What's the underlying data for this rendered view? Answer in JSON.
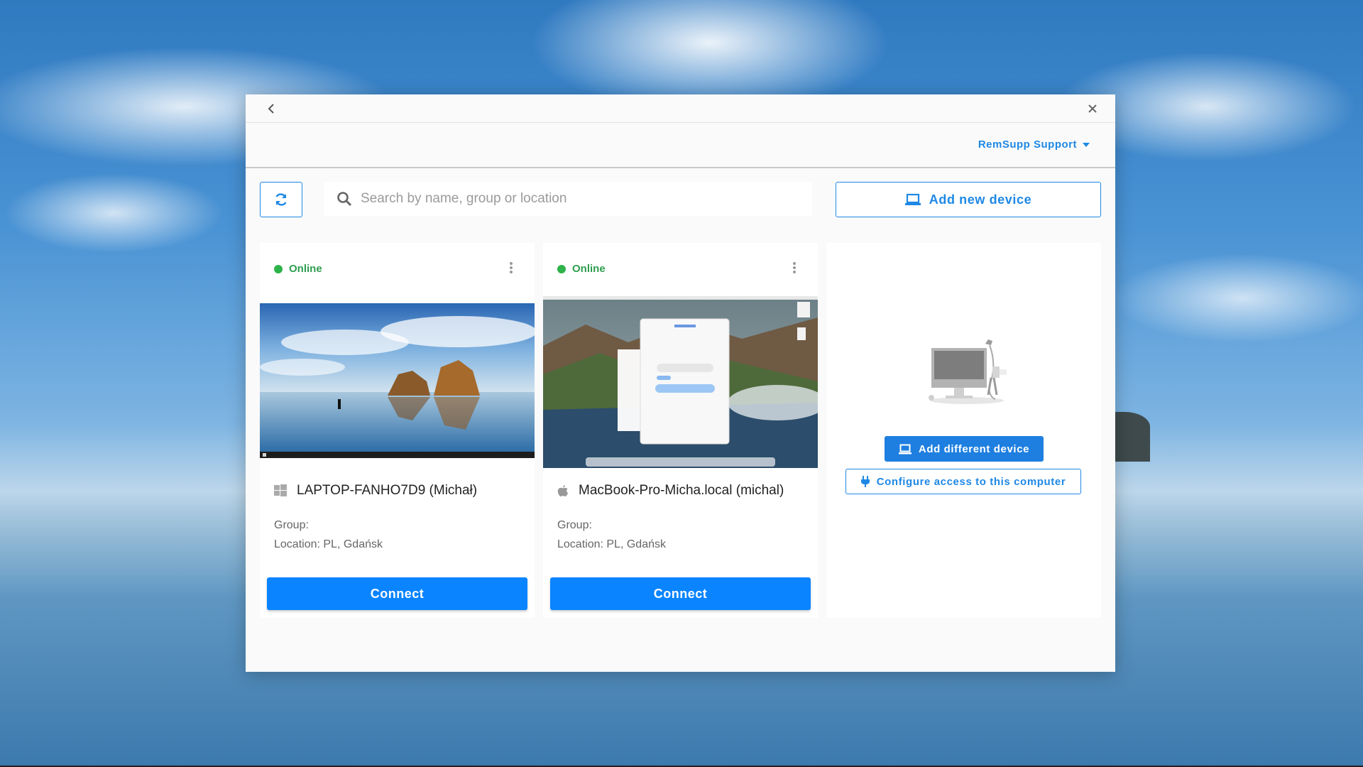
{
  "window": {
    "back_icon": "chevron-left-icon",
    "close_icon": "close-icon"
  },
  "header": {
    "account_label": "RemSupp Support"
  },
  "toolbar": {
    "refresh_icon": "refresh-icon",
    "search_placeholder": "Search by name, group or location",
    "search_value": "",
    "add_new_label": "Add new device"
  },
  "devices": [
    {
      "status": "Online",
      "os_icon": "windows-icon",
      "name": "LAPTOP-FANHO7D9 (Michał)",
      "group": "Group:",
      "location": "Location: PL, Gdańsk",
      "connect_label": "Connect"
    },
    {
      "status": "Online",
      "os_icon": "apple-icon",
      "name": "MacBook-Pro-Micha.local (michal)",
      "group": "Group:",
      "location": "Location: PL, Gdańsk",
      "connect_label": "Connect"
    }
  ],
  "empty_card": {
    "add_different_label": "Add different device",
    "configure_label": "Configure access to this computer"
  },
  "colors": {
    "accent": "#1e88e5",
    "connect": "#0a84ff",
    "online": "#2db34a"
  }
}
